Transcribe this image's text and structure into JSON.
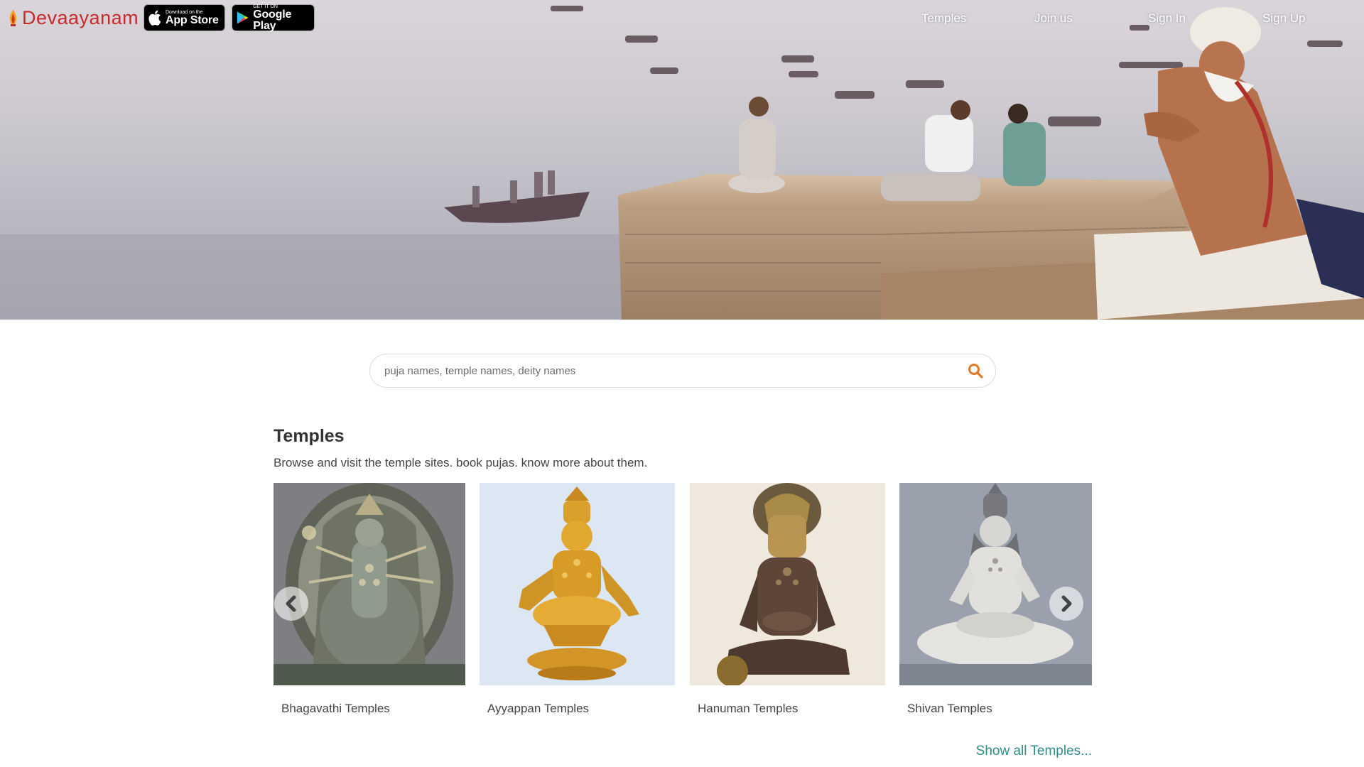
{
  "brand": {
    "name": "Devaayanam"
  },
  "badges": {
    "apple": {
      "small": "Download on the",
      "big": "App Store"
    },
    "google": {
      "small": "GET IT ON",
      "big": "Google Play"
    }
  },
  "nav": {
    "temples": "Temples",
    "join": "Join us",
    "signin": "Sign In",
    "signup": "Sign Up"
  },
  "search": {
    "placeholder": "puja names, temple names, deity names"
  },
  "section": {
    "title": "Temples",
    "subtitle": "Browse and visit the temple sites. book pujas. know more about them."
  },
  "cards": [
    {
      "label": "Bhagavathi Temples",
      "icon": "bhagavathi-idol"
    },
    {
      "label": "Ayyappan Temples",
      "icon": "ayyappan-idol"
    },
    {
      "label": "Hanuman Temples",
      "icon": "hanuman-idol"
    },
    {
      "label": "Shivan Temples",
      "icon": "shivan-idol"
    }
  ],
  "show_all": "Show all Temples...",
  "colors": {
    "brand": "#c62a2a",
    "accent": "#e07b24",
    "link": "#2f8b8b"
  }
}
